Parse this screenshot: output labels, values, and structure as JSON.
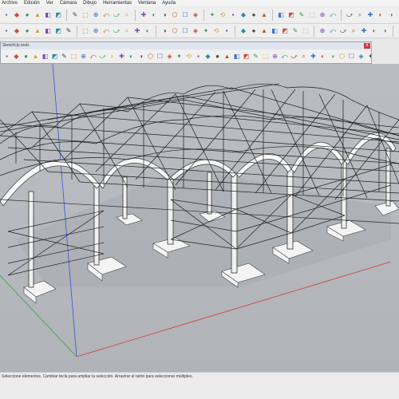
{
  "menu": {
    "items": [
      "Archivo",
      "Edición",
      "Ver",
      "Cámara",
      "Dibujo",
      "Herramientas",
      "Ventana",
      "Ayuda"
    ]
  },
  "toolbar": {
    "row1_icons": [
      "new-icon",
      "open-icon",
      "save-icon",
      "cut-icon",
      "copy-icon",
      "paste-icon",
      "erase-icon",
      "undo-icon",
      "redo-icon",
      "print-icon",
      "select-icon",
      "make-component-icon",
      "paint-bucket-icon",
      "eraser-icon",
      "rectangle-icon",
      "line-icon",
      "circle-icon",
      "arc-icon",
      "polygon-icon",
      "freehand-icon",
      "move-icon",
      "push-pull-icon",
      "rotate-icon",
      "follow-me-icon",
      "scale-icon",
      "offset-icon",
      "tape-measure-icon",
      "dimension-icon",
      "protractor-icon",
      "text-icon",
      "axes-icon",
      "3d-text-icon",
      "orbit-icon",
      "pan-icon",
      "zoom-icon",
      "zoom-window-icon",
      "zoom-extents-icon",
      "previous-view-icon",
      "next-view-icon",
      "position-camera-icon",
      "walk-icon",
      "look-around-icon",
      "section-plane-icon",
      "xray-icon",
      "wireframe-icon",
      "hidden-line-icon",
      "shaded-icon",
      "shaded-textures-icon",
      "monochrome-icon",
      "get-models-icon",
      "share-model-icon",
      "share-component-icon",
      "extension-warehouse-icon",
      "layout-icon",
      "styles-icon",
      "shadows-icon"
    ],
    "row2_icons": [
      "pencil-icon",
      "arc-icon",
      "rectangle-icon",
      "circle-icon",
      "polygon-icon",
      "line-icon",
      "paint-icon",
      "eraser-icon",
      "tape-icon",
      "move-icon",
      "push-pull-icon",
      "rotate-icon",
      "scale-icon",
      "offset-icon",
      "text-icon",
      "iso-view-icon",
      "top-view-icon",
      "front-view-icon",
      "right-view-icon",
      "back-view-icon",
      "left-view-icon",
      "bottom-view-icon",
      "solid-union-icon",
      "solid-subtract-icon",
      "solid-trim-icon",
      "solid-split-icon",
      "sandbox-icon",
      "smoove-icon",
      "stamp-icon",
      "drape-icon",
      "add-detail-icon",
      "flip-edge-icon",
      "match-photo-icon",
      "geo-location-icon",
      "ruby-console-icon",
      "component-icon",
      "group-icon",
      "lock-icon",
      "unlock-icon",
      "hide-icon",
      "unhide-icon",
      "layers-icon"
    ]
  },
  "floating_window": {
    "title": "SketchUp tools",
    "close_label": "x",
    "icons": [
      "line-icon",
      "arc-icon",
      "rectangle-icon",
      "circle-icon",
      "polygon-icon",
      "freehand-icon",
      "move-icon",
      "rotate-icon",
      "scale-icon",
      "push-pull-icon",
      "follow-me-icon",
      "offset-icon",
      "tape-icon",
      "protractor-icon",
      "dimension-icon",
      "text-icon",
      "axes-icon",
      "section-icon",
      "paint-icon",
      "eraser-icon",
      "select-icon",
      "component-icon",
      "orbit-icon",
      "pan-icon",
      "zoom-icon",
      "zoom-window-icon",
      "zoom-extents-icon",
      "walk-icon",
      "look-icon",
      "position-icon",
      "front-icon",
      "back-icon",
      "left-icon",
      "right-icon",
      "top-icon",
      "bottom-icon",
      "iso-icon",
      "xray-icon",
      "wire-icon",
      "hidden-icon",
      "shaded-icon",
      "texture-icon",
      "mono-icon",
      "shadow-icon",
      "fog-icon",
      "edge-icon",
      "profile-icon",
      "depth-cue-icon",
      "extension-icon",
      "endpoint-icon",
      "jitter-icon",
      "style-icon",
      "layer-icon",
      "outliner-icon",
      "entity-info-icon",
      "materials-icon",
      "components-icon",
      "scenes-icon",
      "instructor-icon",
      "solid-icon"
    ]
  },
  "viewport": {
    "model": "structural steel canopy (three bays) with truss roof and concrete footings",
    "background": "#b8bbbf",
    "axis_colors": {
      "red": "#d23a3a",
      "green": "#3aa04a",
      "blue": "#3a54d8"
    }
  },
  "status": {
    "text": "Seleccione elementos. Cambiar tecla para ampliar la selección. Arrastrar el ratón para seleccionar múltiples."
  }
}
